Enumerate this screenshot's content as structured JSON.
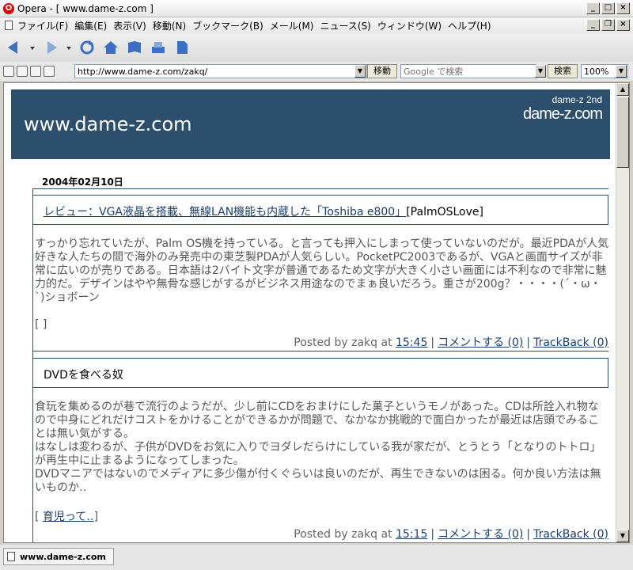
{
  "window": {
    "title": "Opera - [ www.dame-z.com ]"
  },
  "menu": [
    "ファイル(F)",
    "編集(E)",
    "表示(V)",
    "移動(N)",
    "ブックマーク(B)",
    "メール(M)",
    "ニュース(S)",
    "ウィンドウ(W)",
    "ヘルプ(H)"
  ],
  "address": {
    "url": "http://www.dame-z.com/zakq/",
    "go_label": "移動",
    "search_placeholder": "Google で検索",
    "search_label": "検索",
    "zoom": "100%"
  },
  "site": {
    "title": "www.dame-z.com",
    "logo_sub": "dame-z 2nd",
    "logo_main": "dame-z.com"
  },
  "date_heading": "2004年02月10日",
  "entries": [
    {
      "title_link": "レビュー：VGA液晶を搭載、無線LAN機能も内蔵した「Toshiba e800」",
      "title_tag": "[PalmOSLove]",
      "body": "すっかり忘れていたが、Palm OS機を持っている。と言っても押入にしまって使っていないのだが。最近PDAが人気好きな人たちの間で海外のみ発売中の東芝製PDAが人気らしい。PocketPC2003であるが、VGAと画面サイズが非常に広いのが売りである。日本語は2バイト文字が普通であるため文字が大きく小さい画面には不利なので非常に魅力的だ。デザインはやや無骨な感じがするがビジネス用途なのでまぁ良いだろう。重さが200g？・・・・(´・ω・`)ショボーン",
      "category": "[ ]",
      "category_link": "",
      "posted": "Posted by zakq at",
      "time": "15:45",
      "comment": "コメントする (0)",
      "trackback": "TrackBack (0)"
    },
    {
      "title_link": "",
      "title_tag": "DVDを食べる奴",
      "body": "食玩を集めるのが巷で流行のようだが、少し前にCDをおまけにした菓子というモノがあった。CDは所詮入れ物なので中身にどれだけコストをかけることができるかが問題で、なかなか挑戦的で面白かったが最近は店頭でみることは無い気がする。\nはなしは変わるが、子供がDVDをお気に入りでヨダレだらけにしている我が家だが、とうとう「となりのトトロ」が再生中に止まるようになってしまった。\nDVDマニアではないのでメディアに多少傷が付くぐらいは良いのだが、再生できないのは困る。何か良い方法は無いものか‥",
      "category": "[ ]",
      "category_link": "育児って‥",
      "posted": "Posted by zakq at",
      "time": "15:15",
      "comment": "コメントする (0)",
      "trackback": "TrackBack (0)"
    }
  ],
  "status": {
    "tab_label": "www.dame-z.com"
  }
}
